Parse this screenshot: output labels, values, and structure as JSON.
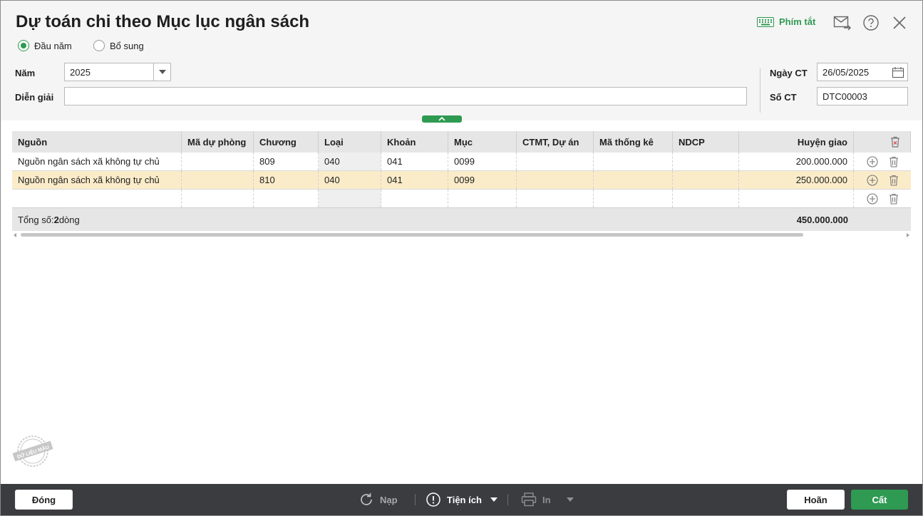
{
  "dialog": {
    "title": "Dự toán chi theo Mục lục ngân sách",
    "shortcut_label": "Phím tắt"
  },
  "options": {
    "radio_1": "Đầu năm",
    "radio_2": "Bổ sung",
    "selected": "Đầu năm"
  },
  "form": {
    "year_label": "Năm",
    "year_value": "2025",
    "description_label": "Diễn giải",
    "description_value": "",
    "date_label": "Ngày CT",
    "date_value": "26/05/2025",
    "doc_no_label": "Số CT",
    "doc_no_value": "DTC00003"
  },
  "grid": {
    "columns": [
      "Nguồn",
      "Mã dự phòng",
      "Chương",
      "Loại",
      "Khoản",
      "Mục",
      "CTMT, Dự án",
      "Mã thống kê",
      "NDCP",
      "Huyện giao"
    ],
    "rows": [
      {
        "nguon": "Nguồn ngân sách xã không tự chủ",
        "ma_du_phong": "",
        "chuong": "809",
        "loai": "040",
        "khoan": "041",
        "muc": "0099",
        "ctmt": "",
        "ma_thong_ke": "",
        "ndcp": "",
        "huyen_giao": "200.000.000"
      },
      {
        "nguon": "Nguồn ngân sách xã không tự chủ",
        "ma_du_phong": "",
        "chuong": "810",
        "loai": "040",
        "khoan": "041",
        "muc": "0099",
        "ctmt": "",
        "ma_thong_ke": "",
        "ndcp": "",
        "huyen_giao": "250.000.000"
      },
      {
        "nguon": "",
        "ma_du_phong": "",
        "chuong": "",
        "loai": "",
        "khoan": "",
        "muc": "",
        "ctmt": "",
        "ma_thong_ke": "",
        "ndcp": "",
        "huyen_giao": ""
      }
    ],
    "total_prefix": "Tổng số: ",
    "total_count": "2",
    "total_suffix": " dòng",
    "total_value": "450.000.000"
  },
  "stamp_text": "DỮ LIỆU MẪU",
  "footer": {
    "close_label": "Đóng",
    "reload_label": "Nạp",
    "utilities_label": "Tiện ích",
    "print_label": "In",
    "cancel_label": "Hoãn",
    "save_label": "Cất"
  },
  "colors": {
    "accent": "#2e9a52",
    "selected_row": "#fbecc9",
    "footer_bg": "#3a3c3f",
    "delete_all_icon": "#e05050"
  }
}
